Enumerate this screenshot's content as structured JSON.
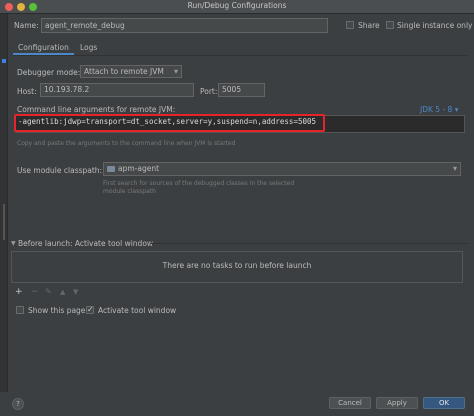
{
  "window": {
    "title": "Run/Debug Configurations"
  },
  "top": {
    "name_label": "Name:",
    "name_value": "agent_remote_debug",
    "share_label": "Share",
    "single_instance_label": "Single instance only"
  },
  "tabs": [
    {
      "label": "Configuration",
      "active": true
    },
    {
      "label": "Logs",
      "active": false
    }
  ],
  "config": {
    "debugger_mode_label": "Debugger mode:",
    "debugger_mode_value": "Attach to remote JVM",
    "host_label": "Host:",
    "host_value": "10.193.78.2",
    "port_label": "Port:",
    "port_value": "5005",
    "cmd_args_label": "Command line arguments for remote JVM:",
    "jdk_selector": "JDK 5 - 8 ▾",
    "cmd_args_value": "-agentlib:jdwp=transport=dt_socket,server=y,suspend=n,address=5005",
    "cmd_hint": "Copy and paste the arguments to the command line when JVM is started",
    "module_classpath_label": "Use module classpath:",
    "module_classpath_value": "apm-agent",
    "module_hint_line1": "First search for sources of the debugged classes in the selected",
    "module_hint_line2": "module classpath"
  },
  "before_launch": {
    "header": "Before launch: Activate tool window",
    "empty_text": "There are no tasks to run before launch",
    "toolbar": [
      "+",
      "−",
      "✎",
      "▲",
      "▼"
    ],
    "show_page_label": "Show this page",
    "activate_tool_window_label": "Activate tool window"
  },
  "footer": {
    "help_icon": "?",
    "cancel_label": "Cancel",
    "apply_label": "Apply",
    "ok_label": "OK"
  },
  "colors": {
    "accent": "#4a88c7",
    "highlight_box": "#e5232c",
    "primary_button": "#365880"
  }
}
